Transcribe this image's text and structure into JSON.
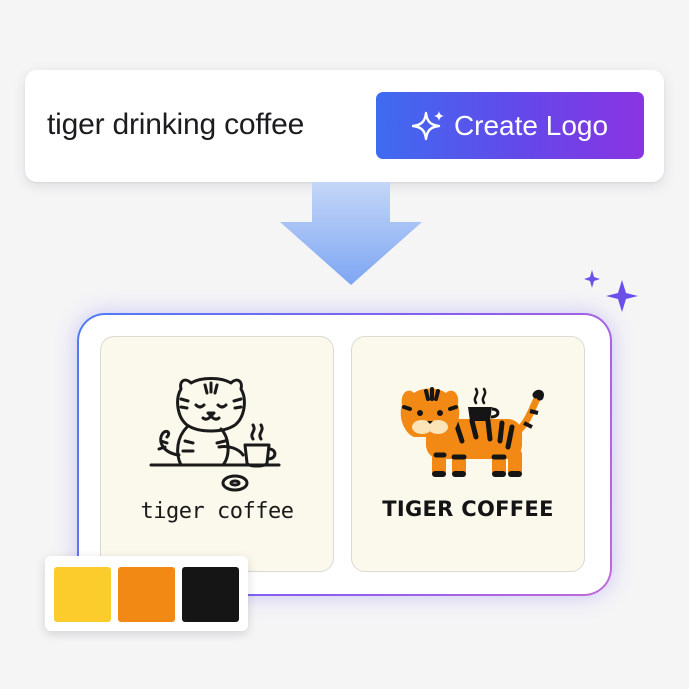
{
  "prompt": {
    "query_text": "tiger drinking coffee",
    "button_label": "Create Logo",
    "button_icon": "sparkle-icon"
  },
  "results": {
    "logos": [
      {
        "caption": "tiger coffee",
        "style": "line-art",
        "icon": "tiger-with-coffee-cup-icon"
      },
      {
        "caption": "TIGER COFFEE",
        "style": "flat-color",
        "icon": "walking-tiger-with-coffee-cup-icon"
      }
    ]
  },
  "palette": {
    "colors": [
      "#fccb2c",
      "#f28914",
      "#151515"
    ]
  },
  "decor": {
    "arrow_color": "#8eb2f6",
    "sparkle_color": "#6a4fe8"
  }
}
